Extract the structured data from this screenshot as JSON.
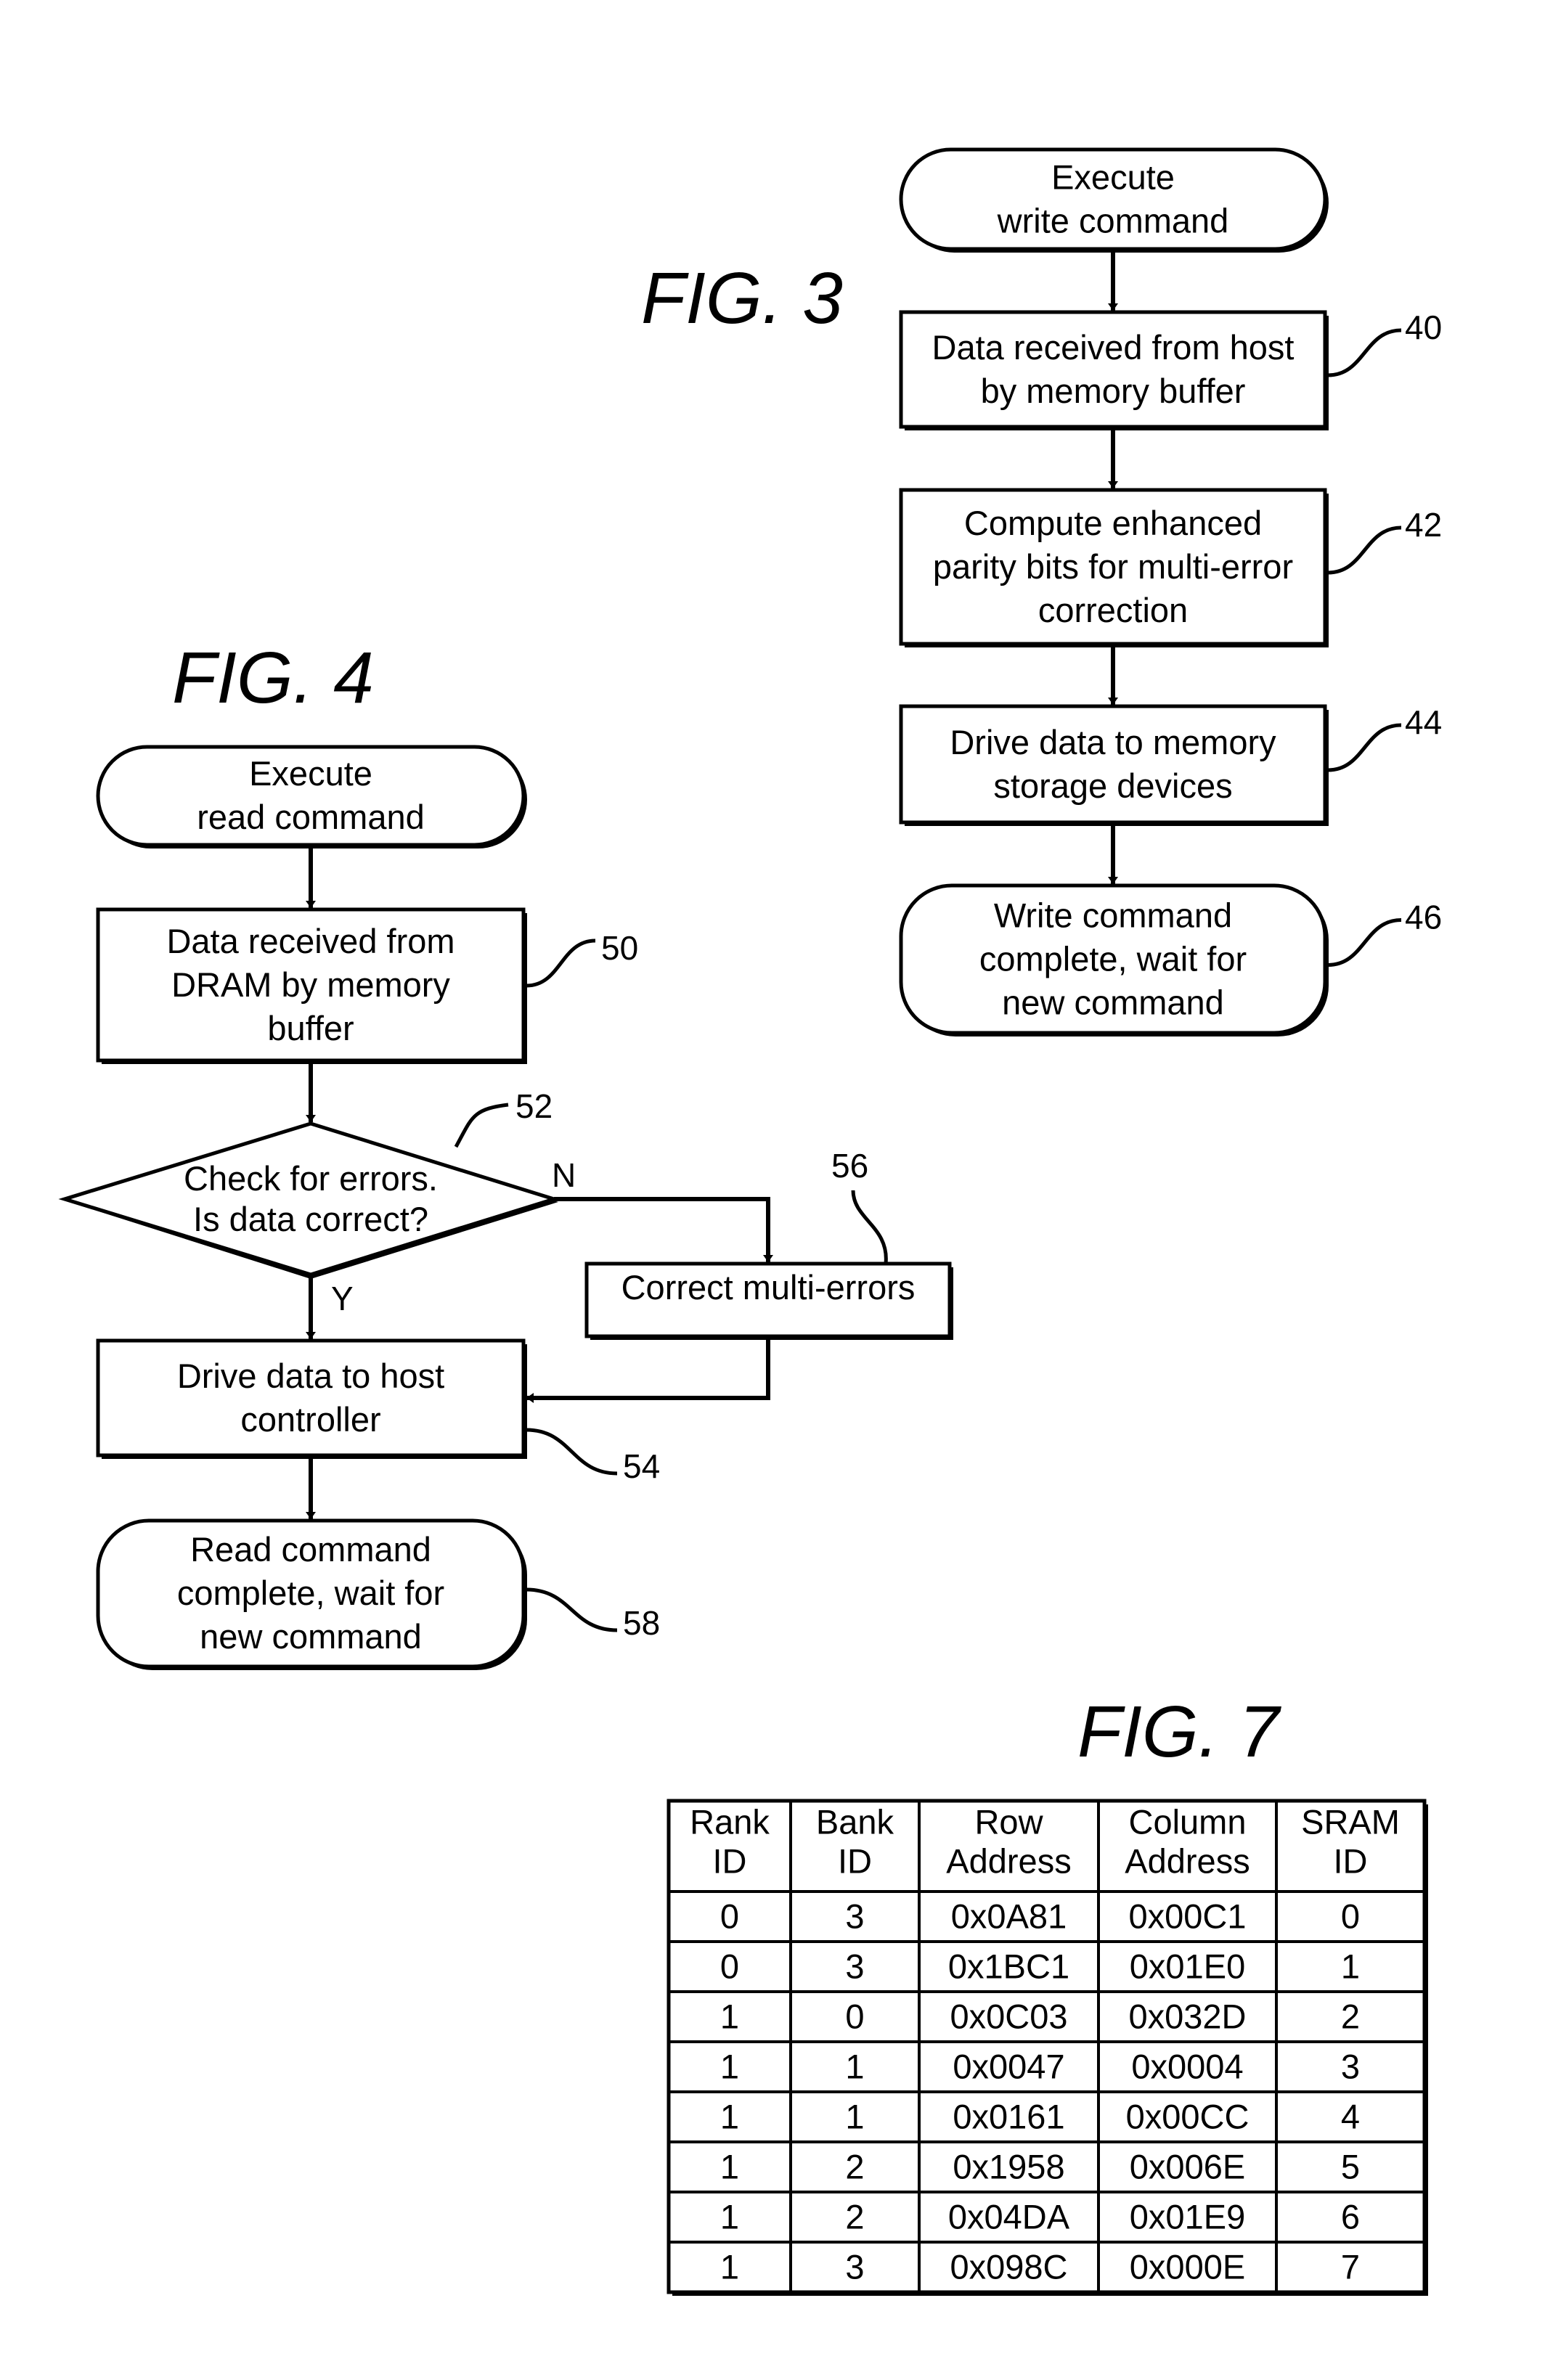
{
  "figures": {
    "fig3": {
      "title": "FIG. 3",
      "nodes": [
        {
          "id": "start",
          "shape": "terminal",
          "lines": [
            "Execute",
            "write command"
          ],
          "ref": ""
        },
        {
          "id": "n40",
          "shape": "process",
          "lines": [
            "Data received from host",
            "by memory buffer"
          ],
          "ref": "40"
        },
        {
          "id": "n42",
          "shape": "process",
          "lines": [
            "Compute enhanced",
            "parity bits for multi-error",
            "correction"
          ],
          "ref": "42"
        },
        {
          "id": "n44",
          "shape": "process",
          "lines": [
            "Drive data to memory",
            "storage devices"
          ],
          "ref": "44"
        },
        {
          "id": "n46",
          "shape": "terminal",
          "lines": [
            "Write command",
            "complete, wait for",
            "new command"
          ],
          "ref": "46"
        }
      ]
    },
    "fig4": {
      "title": "FIG. 4",
      "nodes": [
        {
          "id": "start",
          "shape": "terminal",
          "lines": [
            "Execute",
            "read command"
          ],
          "ref": ""
        },
        {
          "id": "n50",
          "shape": "process",
          "lines": [
            "Data received from",
            "DRAM by memory",
            "buffer"
          ],
          "ref": "50"
        },
        {
          "id": "n52",
          "shape": "decision",
          "lines": [
            "Check for errors.",
            "Is data correct?"
          ],
          "ref": "52"
        },
        {
          "id": "n56",
          "shape": "process",
          "lines": [
            "Correct multi-errors"
          ],
          "ref": "56"
        },
        {
          "id": "n54",
          "shape": "process",
          "lines": [
            "Drive data to host",
            "controller"
          ],
          "ref": "54"
        },
        {
          "id": "n58",
          "shape": "terminal",
          "lines": [
            "Read command",
            "complete, wait for",
            "new command"
          ],
          "ref": "58"
        }
      ],
      "branch_labels": {
        "no": "N",
        "yes": "Y"
      }
    },
    "fig7": {
      "title": "FIG. 7",
      "columns": [
        [
          "Rank",
          "ID"
        ],
        [
          "Bank",
          "ID"
        ],
        [
          "Row",
          "Address"
        ],
        [
          "Column",
          "Address"
        ],
        [
          "SRAM",
          "ID"
        ]
      ],
      "rows": [
        [
          "0",
          "3",
          "0x0A81",
          "0x00C1",
          "0"
        ],
        [
          "0",
          "3",
          "0x1BC1",
          "0x01E0",
          "1"
        ],
        [
          "1",
          "0",
          "0x0C03",
          "0x032D",
          "2"
        ],
        [
          "1",
          "1",
          "0x0047",
          "0x0004",
          "3"
        ],
        [
          "1",
          "1",
          "0x0161",
          "0x00CC",
          "4"
        ],
        [
          "1",
          "2",
          "0x1958",
          "0x006E",
          "5"
        ],
        [
          "1",
          "2",
          "0x04DA",
          "0x01E9",
          "6"
        ],
        [
          "1",
          "3",
          "0x098C",
          "0x000E",
          "7"
        ]
      ]
    }
  }
}
